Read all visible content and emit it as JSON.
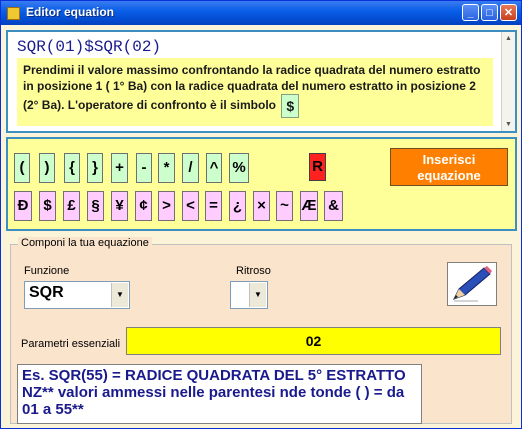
{
  "window": {
    "title": "Editor equation"
  },
  "titlebar_buttons": {
    "minimize": "_",
    "maximize": "□",
    "close": "✕"
  },
  "equation": {
    "code": "SQR(01)$SQR(02)",
    "description": "Prendimi il valore massimo confrontando la radice quadrata del numero estratto in posizione 1 ( 1° Ba) con la radice quadrata del numero estratto in posizione 2 (2° Ba). L'operatore di confronto è il simbolo",
    "operator_symbol": "$"
  },
  "symbols": {
    "row1": [
      "(",
      ")",
      "{",
      "}",
      "+",
      "-",
      "*",
      "/",
      "^",
      "%"
    ],
    "row2": [
      "Đ",
      "$",
      "£",
      "§",
      "¥",
      "¢",
      ">",
      "<",
      "=",
      "¿",
      "×",
      "~",
      "Æ",
      "&"
    ],
    "r_button": "R",
    "insert_button": "Inserisci equazione"
  },
  "compose": {
    "legend": "Componi la tua equazione",
    "funzione_label": "Funzione",
    "funzione_value": "SQR",
    "ritroso_label": "Ritroso",
    "ritroso_value": "",
    "param_label": "Parametri essenziali",
    "param_value": "02",
    "example_text": "Es. SQR(55)  = RADICE QUADRATA DEL 5° ESTRATTO NZ** valori ammessi  nelle parentesi nde tonde ( ) = da 01 a 55**"
  }
}
